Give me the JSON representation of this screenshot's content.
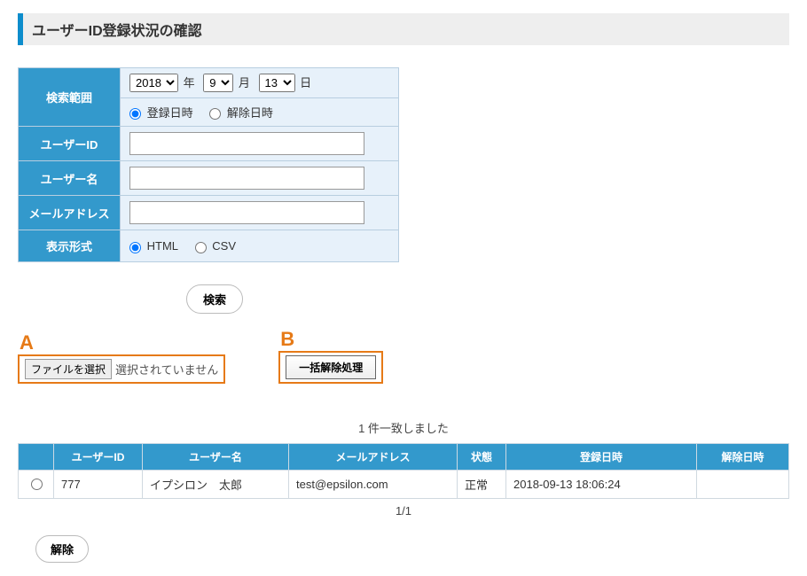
{
  "header": {
    "title": "ユーザーID登録状況の確認"
  },
  "form": {
    "labels": {
      "search_range": "検索範囲",
      "user_id": "ユーザーID",
      "user_name": "ユーザー名",
      "email": "メールアドレス",
      "display_format": "表示形式"
    },
    "date": {
      "year": "2018",
      "year_unit": "年",
      "month": "9",
      "month_unit": "月",
      "day": "13",
      "day_unit": "日"
    },
    "range_options": {
      "registered": "登録日時",
      "released": "解除日時"
    },
    "format_options": {
      "html": "HTML",
      "csv": "CSV"
    },
    "values": {
      "user_id": "",
      "user_name": "",
      "email": ""
    }
  },
  "buttons": {
    "search": "検索",
    "file_choose": "ファイルを選択",
    "file_status": "選択されていません",
    "batch_release": "一括解除処理",
    "release": "解除"
  },
  "annotations": {
    "a": "A",
    "b": "B"
  },
  "results": {
    "count_text": "1 件一致しました",
    "columns": {
      "user_id": "ユーザーID",
      "user_name": "ユーザー名",
      "email": "メールアドレス",
      "status": "状態",
      "registered_at": "登録日時",
      "released_at": "解除日時"
    },
    "rows": [
      {
        "user_id": "777",
        "user_name": "イプシロン　太郎",
        "email": "test@epsilon.com",
        "status": "正常",
        "registered_at": "2018-09-13 18:06:24",
        "released_at": ""
      }
    ],
    "pagination": "1/1"
  }
}
